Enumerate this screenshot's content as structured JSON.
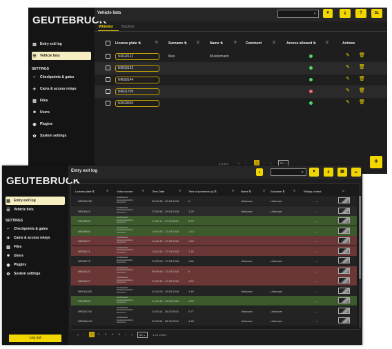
{
  "brand": "GEUTEBRUCK",
  "s1": {
    "title": "Vehicle lists",
    "search_icon": "⌕",
    "nav": [
      {
        "label": "Entry exit log",
        "icon": "▤"
      },
      {
        "label": "Vehicle lists",
        "icon": "☰"
      }
    ],
    "settings_label": "SETTINGS",
    "settings": [
      {
        "label": "Checkpoints & gates",
        "icon": "⌐"
      },
      {
        "label": "Cams & access relays",
        "icon": "✈"
      },
      {
        "label": "Files",
        "icon": "▨"
      },
      {
        "label": "Users",
        "icon": "☻"
      },
      {
        "label": "Plugins",
        "icon": "◉"
      },
      {
        "label": "System settings",
        "icon": "✿"
      }
    ],
    "tabs": {
      "white": "Whitelist",
      "black": "Blacklist"
    },
    "headers": {
      "plate": "License plate ⇅",
      "surname": "Surname ⇅",
      "name": "Name ⇅",
      "comment": "Comment",
      "access": "Access allowed ⇅",
      "actions": "Actions"
    },
    "rows": [
      {
        "plate": "NRG8122",
        "surname": "Max",
        "name": "Mustermann",
        "status": "green",
        "status_color": "#4cd964"
      },
      {
        "plate": "NRG8132",
        "surname": "",
        "name": "",
        "status": "green",
        "status_color": "#4cd964"
      },
      {
        "plate": "NRG8144",
        "surname": "",
        "name": "",
        "status": "green",
        "status_color": "#4cd964"
      },
      {
        "plate": "NRG1700",
        "surname": "",
        "name": "",
        "status": "red",
        "status_color": "#ff6b6b"
      },
      {
        "plate": "NRG8600",
        "surname": "",
        "name": "",
        "status": "green",
        "status_color": "#4cd964"
      }
    ],
    "pagination": {
      "label": "1-5 of 5",
      "page": "1",
      "rows_per_page": "20"
    },
    "fab": "+"
  },
  "s2": {
    "title": "Entry exit log",
    "nav": [
      {
        "label": "Entry exit log",
        "icon": "▤"
      },
      {
        "label": "Vehicle lists",
        "icon": "☰"
      }
    ],
    "settings_label": "SETTINGS",
    "settings": [
      {
        "label": "Checkpoints & gates",
        "icon": "⌐"
      },
      {
        "label": "Cams & access relays",
        "icon": "✈"
      },
      {
        "label": "Files",
        "icon": "▨"
      },
      {
        "label": "Users",
        "icon": "☻"
      },
      {
        "label": "Plugins",
        "icon": "◉"
      },
      {
        "label": "System settings",
        "icon": "✿"
      }
    ],
    "headers": {
      "plate": "License plate ⇅",
      "video": "Video source",
      "time": "Time Date",
      "presence": "Time of presence (s) ⇅",
      "name": "Name ⇅",
      "surname": "Surname ⇅",
      "relays": "Relays control"
    },
    "rows": [
      {
        "plate": "NRG8122E",
        "time": "09:09:45 - 29.03.2024",
        "presence": "0",
        "name": "Unknown",
        "surname": "Unknown",
        "bg": "#232323"
      },
      {
        "plate": "NRG8443",
        "time": "07:54:35 - 29.03.2024",
        "presence": "1.25",
        "name": "Unknown",
        "surname": "Unknown",
        "bg": "#2a2a2a"
      },
      {
        "plate": "NRG8600",
        "time": "17:00:11 - 27.03.2024",
        "presence": "3.75",
        "name": "",
        "surname": "",
        "bg": "#3c5a2c"
      },
      {
        "plate": "NRG8600",
        "time": "14:51:53 - 27.03.2024",
        "presence": "1.13",
        "name": "",
        "surname": "",
        "bg": "#3c5a2c"
      },
      {
        "plate": "NRG8107",
        "time": "14:06:32 - 27.03.2024",
        "presence": "1.63",
        "name": "",
        "surname": "",
        "bg": "#6a3636"
      },
      {
        "plate": "NRG8171",
        "time": "13:41:52 - 27.03.2024",
        "presence": "1.75",
        "name": "",
        "surname": "",
        "bg": "#6a3636"
      },
      {
        "plate": "NRG8175",
        "time": "13:32:09 - 27.03.2024",
        "presence": "1.84",
        "name": "Unknown",
        "surname": "Unknown",
        "bg": "#232323"
      },
      {
        "plate": "NRG8121",
        "time": "09:09:45 - 27.03.2024",
        "presence": "0",
        "name": "",
        "surname": "",
        "bg": "#6a3636"
      },
      {
        "plate": "NRG8107",
        "time": "07:00:49 - 27.03.2024",
        "presence": "1.52",
        "name": "",
        "surname": "",
        "bg": "#6a3636"
      },
      {
        "plate": "NRG8132E",
        "time": "10:12:20 - 26.03.2024",
        "presence": "1.49",
        "name": "Unknown",
        "surname": "Unknown",
        "bg": "#232323"
      },
      {
        "plate": "NRG8600",
        "time": "14:16:45 - 26.03.2024",
        "presence": "1.59",
        "name": "",
        "surname": "",
        "bg": "#3c5a2c"
      },
      {
        "plate": "NRG81700",
        "time": "11:40:16 - 26.03.2024",
        "presence": "0.77",
        "name": "Unknown",
        "surname": "Unknown",
        "bg": "#232323"
      },
      {
        "plate": "NRG8444C",
        "time": "11:05:06 - 25.03.2024",
        "presence": "4.28",
        "name": "Unknown",
        "surname": "Unknown",
        "bg": "#232323"
      }
    ],
    "video_text": [
      "Grabdeleink",
      "Netzwerk.Einfahrt",
      "Cam.01.in"
    ],
    "relay_dash": "—",
    "pagination": {
      "pages": [
        "1",
        "2",
        "3",
        "4",
        "5"
      ],
      "rows_per_page": "20",
      "label": "1-20 of 801"
    },
    "logout": "Log out"
  }
}
